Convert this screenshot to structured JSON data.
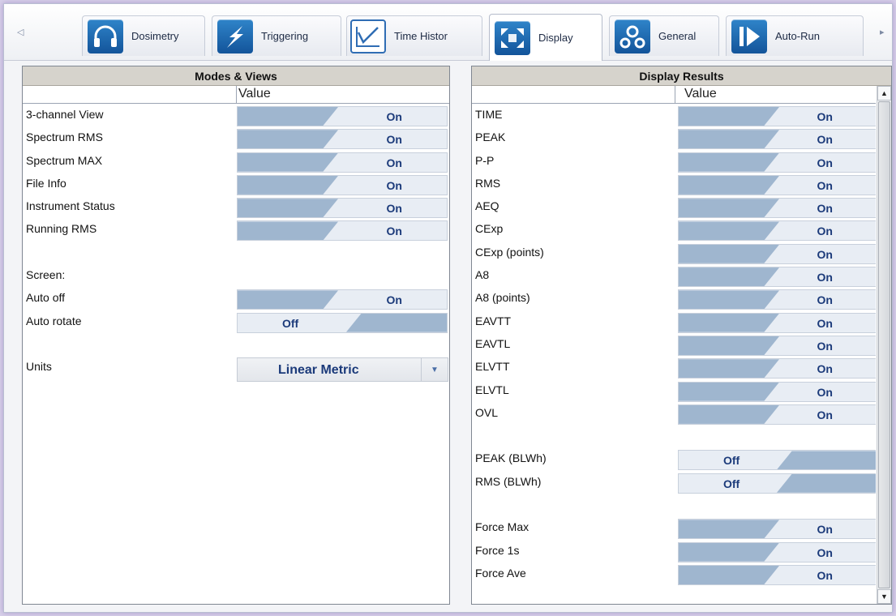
{
  "tabs": [
    {
      "label": "Dosimetry",
      "icon": "headphones-icon",
      "active": false
    },
    {
      "label": "Triggering",
      "icon": "lightning-icon",
      "active": false
    },
    {
      "label": "Time Histor",
      "icon": "line-chart-icon",
      "active": false
    },
    {
      "label": "Display",
      "icon": "expand-arrows-icon",
      "active": true
    },
    {
      "label": "General",
      "icon": "gears-icon",
      "active": false
    },
    {
      "label": "Auto-Run",
      "icon": "play-icon",
      "active": false
    }
  ],
  "nav": {
    "left_arrow": "◁",
    "right_arrow": "▸"
  },
  "modes": {
    "title": "Modes & Views",
    "value_header": "Value",
    "rows": [
      {
        "label": "3-channel View",
        "value": "On"
      },
      {
        "label": "Spectrum RMS",
        "value": "On"
      },
      {
        "label": "Spectrum MAX",
        "value": "On"
      },
      {
        "label": "File Info",
        "value": "On"
      },
      {
        "label": "Instrument Status",
        "value": "On"
      },
      {
        "label": "Running RMS",
        "value": "On"
      }
    ],
    "screen_label": "Screen:",
    "screen_rows": [
      {
        "label": "Auto off",
        "value": "On"
      },
      {
        "label": "Auto rotate",
        "value": "Off"
      }
    ],
    "units_label": "Units",
    "units_value": "Linear Metric"
  },
  "results": {
    "title": "Display Results",
    "value_header": "Value",
    "rows": [
      {
        "label": "TIME",
        "value": "On"
      },
      {
        "label": "PEAK",
        "value": "On"
      },
      {
        "label": "P-P",
        "value": "On"
      },
      {
        "label": "RMS",
        "value": "On"
      },
      {
        "label": "AEQ",
        "value": "On"
      },
      {
        "label": "CExp",
        "value": "On"
      },
      {
        "label": "CExp (points)",
        "value": "On"
      },
      {
        "label": "A8",
        "value": "On"
      },
      {
        "label": "A8 (points)",
        "value": "On"
      },
      {
        "label": "EAVTT",
        "value": "On"
      },
      {
        "label": "EAVTL",
        "value": "On"
      },
      {
        "label": "ELVTT",
        "value": "On"
      },
      {
        "label": "ELVTL",
        "value": "On"
      },
      {
        "label": "OVL",
        "value": "On"
      }
    ],
    "blwh_rows": [
      {
        "label": "PEAK (BLWh)",
        "value": "Off"
      },
      {
        "label": "RMS (BLWh)",
        "value": "Off"
      }
    ],
    "force_rows": [
      {
        "label": "Force Max",
        "value": "On"
      },
      {
        "label": "Force 1s",
        "value": "On"
      },
      {
        "label": "Force Ave",
        "value": "On"
      }
    ],
    "scroll_up": "▲",
    "scroll_down": "▼"
  }
}
